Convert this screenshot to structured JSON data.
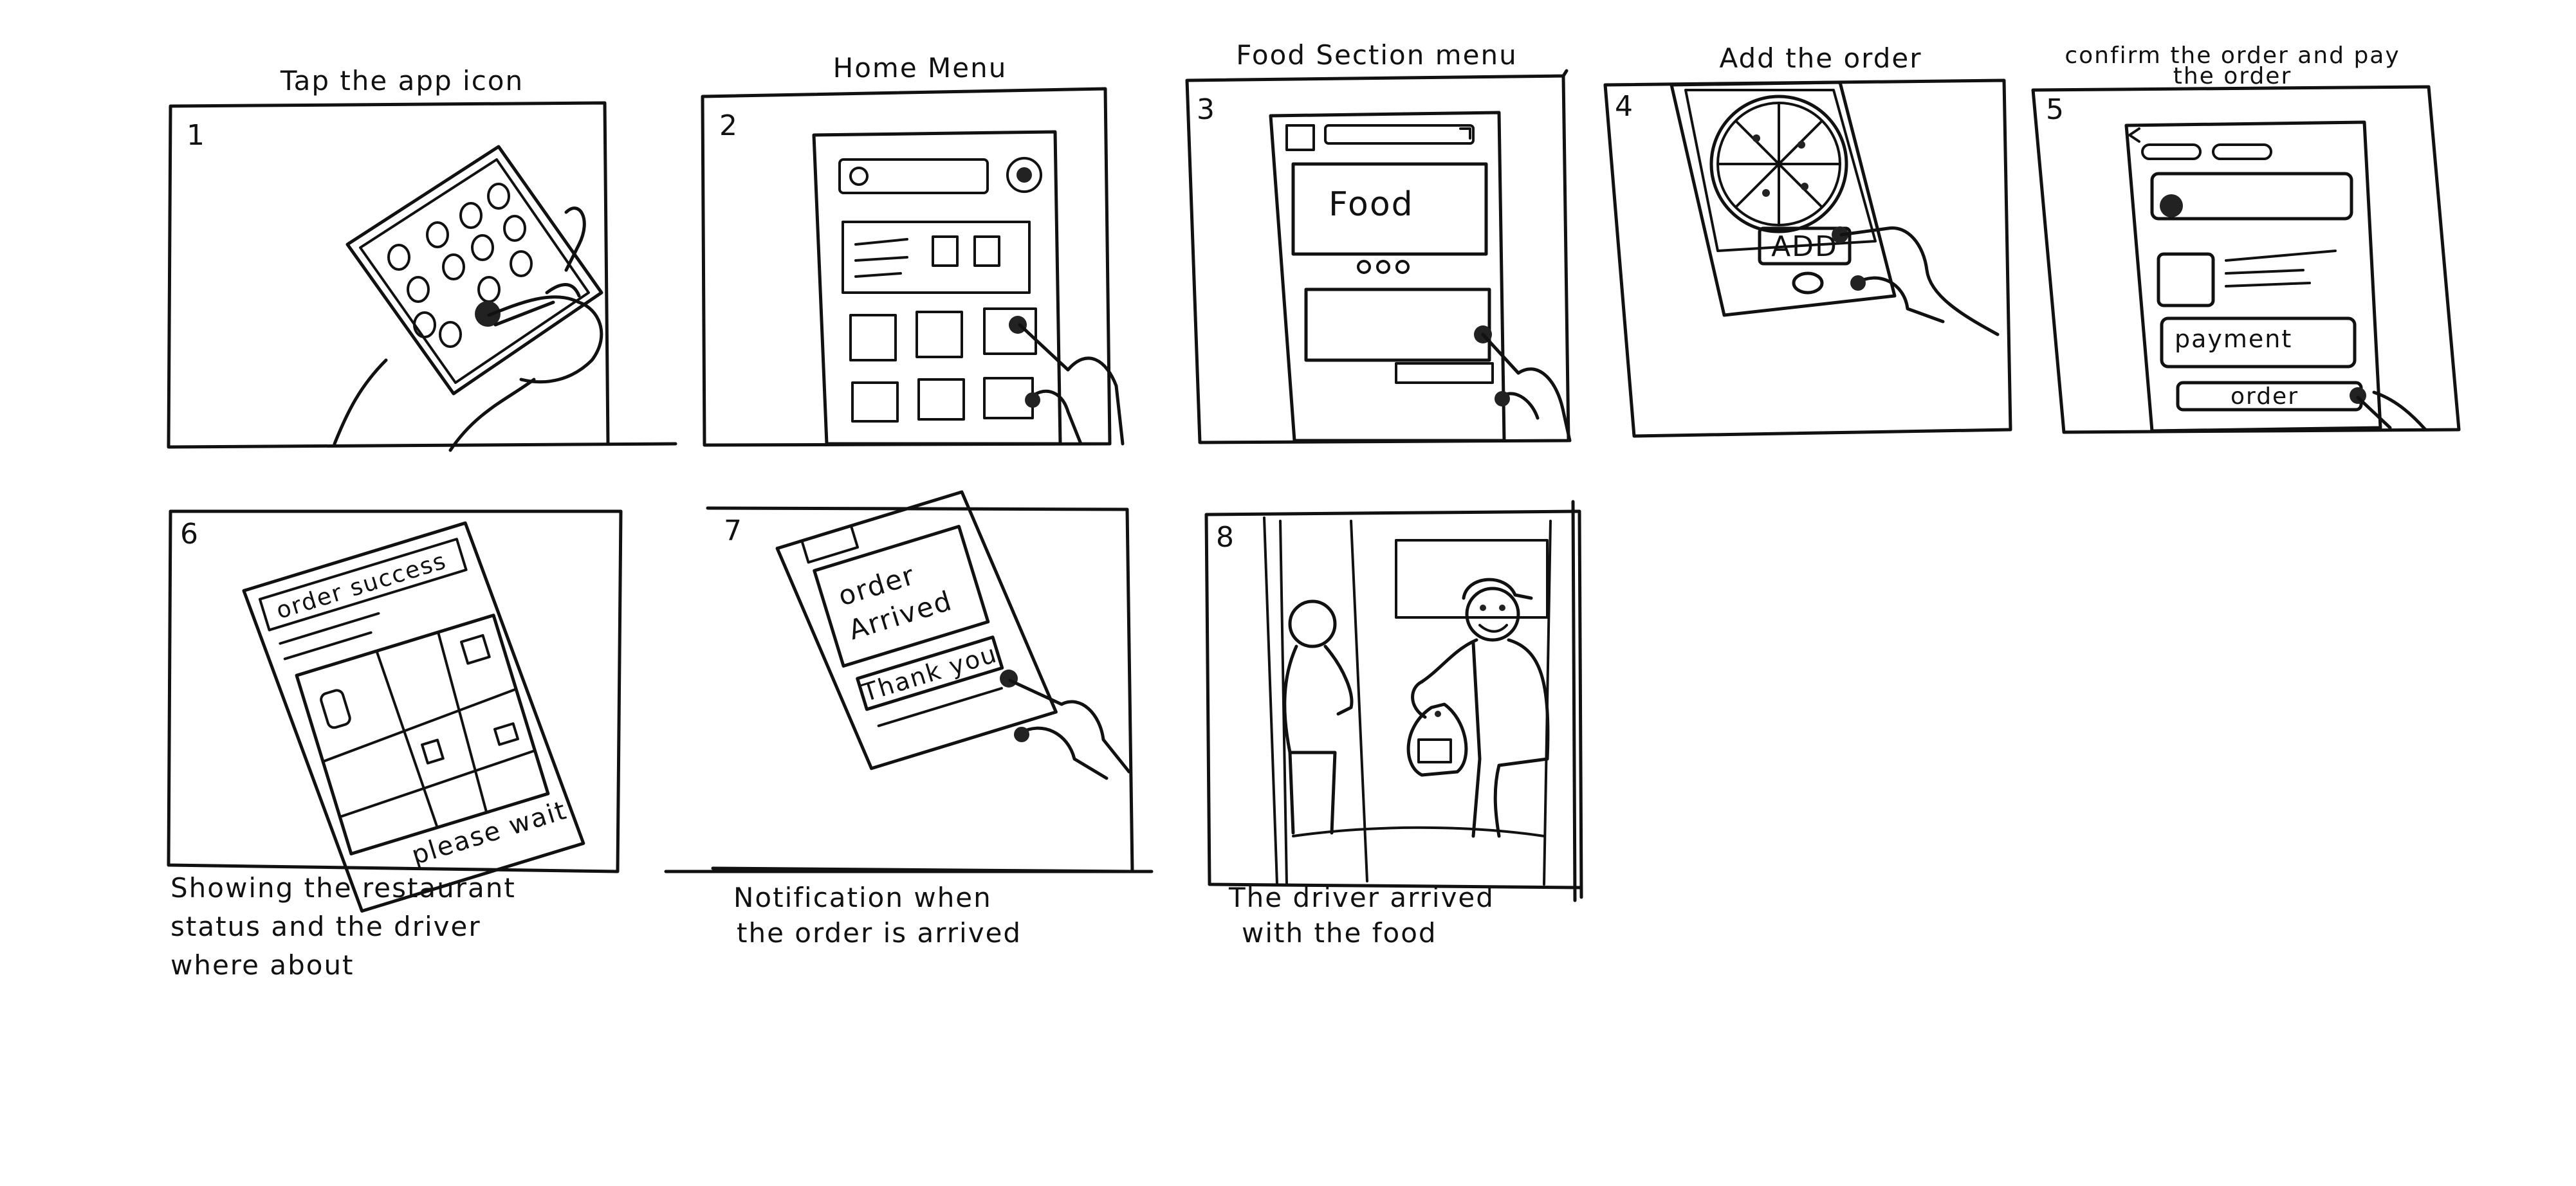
{
  "panels": [
    {
      "number": "1",
      "title": "Tap the app icon",
      "caption": []
    },
    {
      "number": "2",
      "title": "Home Menu",
      "caption": []
    },
    {
      "number": "3",
      "title": "Food Section menu",
      "caption": [],
      "screen_text": "Food"
    },
    {
      "number": "4",
      "title": "Add the order",
      "caption": [],
      "button": "ADD"
    },
    {
      "number": "5",
      "title": [
        "confirm the order and pay",
        "the order"
      ],
      "caption": [],
      "fields": [
        "payment",
        "order"
      ]
    },
    {
      "number": "6",
      "title": "",
      "caption": [
        "Showing the restaurant",
        "status and the driver",
        "where about"
      ],
      "screen_header": "order success",
      "screen_footer": "please wait"
    },
    {
      "number": "7",
      "title": "",
      "caption": [
        "Notification when",
        "the order is arrived"
      ],
      "message": [
        "order",
        "Arrived"
      ],
      "button": "Thank you"
    },
    {
      "number": "8",
      "title": "",
      "caption": [
        "The driver arrived",
        "with the food"
      ]
    }
  ],
  "colors": {
    "ink": "#111111",
    "paper": "#ffffff"
  }
}
